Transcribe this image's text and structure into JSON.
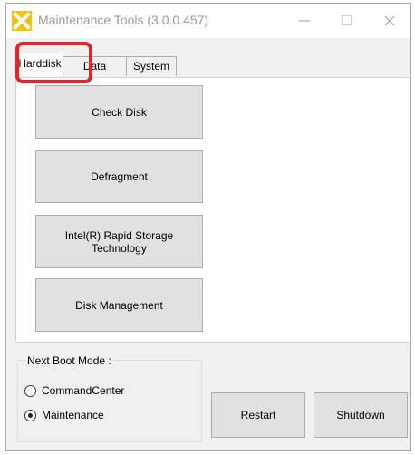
{
  "window": {
    "title": "Maintenance Tools (3.0.0.457)",
    "icon": "yellow-x-app-icon",
    "controls": [
      "minimize-icon",
      "maximize-icon",
      "close-icon"
    ]
  },
  "tabs": [
    {
      "label": "Harddisk",
      "active": true
    },
    {
      "label": "Data",
      "active": false
    },
    {
      "label": "System",
      "active": false
    }
  ],
  "harddisk_panel": {
    "check_disk": "Check Disk",
    "defragment": "Defragment",
    "rst_line1": "Intel(R) Rapid Storage",
    "rst_line2": "Technology",
    "disk_management": "Disk Management"
  },
  "boot_mode": {
    "label": "Next Boot Mode :",
    "options": [
      {
        "label": "CommandCenter",
        "checked": false
      },
      {
        "label": "Maintenance",
        "checked": true
      }
    ]
  },
  "actions": {
    "restart": "Restart",
    "shutdown": "Shutdown"
  },
  "colors": {
    "highlight": "#e8202a",
    "icon_yellow": "#f5c400",
    "window_bg": "#f0f0f0",
    "button_bg": "#e1e1e1"
  }
}
